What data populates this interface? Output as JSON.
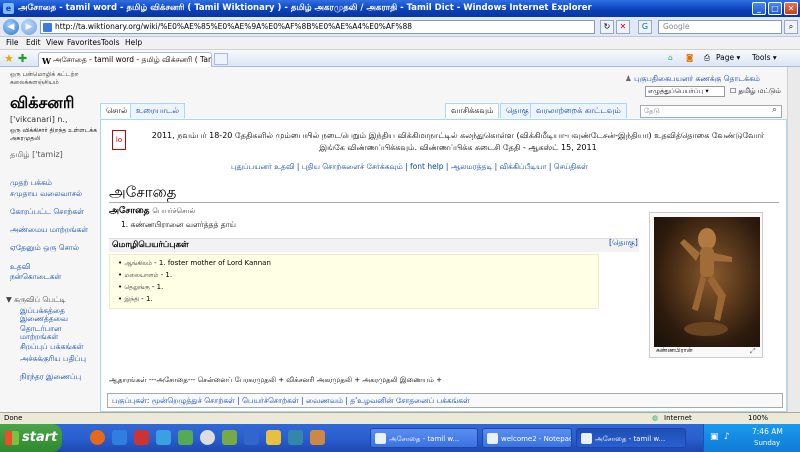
{
  "window": {
    "title": "அசோதை - tamil word - தமிழ் விக்சனரி ( Tamil Wiktionary ) - தமிழ் அகரமுதலி / அகராதி - Tamil Dict - Windows Internet Explorer",
    "min": "_",
    "max": "□",
    "close": "✕"
  },
  "address": {
    "url": "http://ta.wiktionary.org/wiki/%E0%AE%85%E0%AE%9A%E0%AF%8B%E0%AE%A4%E0%AF%88",
    "search_placeholder": "Google"
  },
  "menu": [
    "File",
    "Edit",
    "View",
    "Favorites",
    "Tools",
    "Help"
  ],
  "tabbar": {
    "tab_label": "அசோதை - tamil word - தமிழ் விக்சனரி ( Tamil ...",
    "page": "Page ▾",
    "tools": "Tools ▾"
  },
  "site": {
    "tagline": "ஒரு பன்மொழிக் கட்டற்ற கலைக்களஞ்சியம்",
    "title": "விக்சனரி",
    "ipa": "['vikcanari] n.,",
    "description": "ஒரு விக்கிசார் திறந்த உள்ளடக்க அகரமுதலி",
    "tamiz": "தமிழ் ['tamiz]"
  },
  "sidebar": [
    "முதற் பக்கம்",
    "சமுதாய வலைவாசல்",
    "கோரப்பட்ட சொற்கள்",
    "அண்மைய மாற்றங்கள்",
    "ஏதேனும் ஒரு சொல்",
    "உதவி",
    "நன்கொடைகள்"
  ],
  "toolbox": {
    "heading": "கருவிப் பெட்டி",
    "items": [
      "இப்பக்கத்தை இணைத்தவை",
      "தொடர்பான மாற்றங்கள்",
      "சிறப்புப் பக்கங்கள்",
      "அச்சுக்குரிய பதிப்பு",
      "நிரந்தர இணைப்பு"
    ]
  },
  "personal": {
    "login": "புகுபதிகைபயனர் கணக்கு தொடக்கம்",
    "lang_select": "எழுத்துப்பெயர்ப்பு",
    "lang_option": "தமிழ் மட்டும்"
  },
  "tabs": {
    "word": "சொல்",
    "talk": "உரையாடல்",
    "read": "வாசிக்கவும்",
    "edit": "தொகு",
    "history": "வரலாற்றைக் காட்டவும்",
    "search_placeholder": "தேடு"
  },
  "notice": {
    "img_label": "lo",
    "text": "2011, நவம்பர் 18-20 தேதிகளில் மும்பையில் நடைபெறும் இந்திய விக்கிமாநாட்டில் கலந்துகொள்ள (விக்கிமீடியா-பவுண்டேசன்-இந்தியா) உதவித்தொகை வேண்டுவோர் இங்கே விண்ணப்பிக்கவும். விண்ணப்பிக்க கடைசி தேதி - ஆகஸ்ட் 15, 2011"
  },
  "quicklinks": "புதுப்பயனர் உதவி  |  புதிய சொற்களைச் சேர்க்கவும்  |  font help  |  ஆலமரத்தடி  |  விக்கிப்பீடியா  |  செய்திகள்",
  "entry": {
    "heading": "அசோதை",
    "word": "அசோதை",
    "pos": "பெயர்ச்சொல்",
    "definition": "1.   கண்ணபிரானை வளர்த்தத் தாய்",
    "translations_heading": "மொழிபெயர்ப்புகள்",
    "edit_link": "[தொகு]",
    "translations": [
      {
        "lang": "ஆங்கிலம்",
        "text": "- 1. foster mother of Lord Kannan"
      },
      {
        "lang": "மலையாளம்",
        "text": "- 1."
      },
      {
        "lang": "தெலுங்கு",
        "text": "- 1."
      },
      {
        "lang": "இந்தி",
        "text": "- 1."
      }
    ],
    "figure_caption": "கண்ணபிரான்",
    "refs": "ஆதாரங்கள் ---அசோதை--- சென்னைப் பேரகரமுதலி + விக்சனரி அகரமுதலி + அகரமுதலி இணையம் +",
    "categories": "பகுப்புகள்: மூன்றெழுத்துச் சொற்கள் | பெயர்ச்சொற்கள் | வைணவம் | த'உழவனின் சோதனைப் பக்கங்கள்"
  },
  "status": {
    "left": "Done",
    "zone": "Internet",
    "zoom": "100%"
  },
  "taskbar": {
    "start": "start",
    "tasks": [
      "அசோதை - tamil w...",
      "welcome2 - Notepad",
      "அசோதை - tamil w..."
    ],
    "time": "7:46 AM",
    "day": "Sunday"
  }
}
